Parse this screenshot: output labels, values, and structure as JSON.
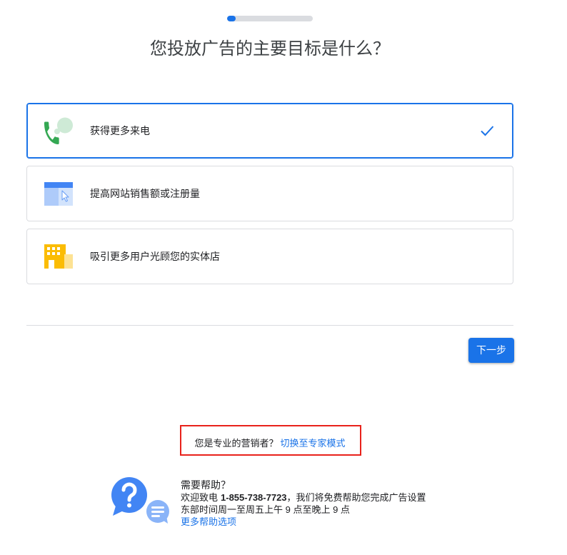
{
  "progress": {
    "percent": 10
  },
  "colors": {
    "accent": "#1a73e8",
    "text": "#202124",
    "border": "#dadce0",
    "highlight": "#e8221b"
  },
  "title": "您投放广告的主要目标是什么？",
  "selected_icon": "check-icon",
  "goals": [
    {
      "label": "获得更多来电",
      "icon": "phone-icon",
      "selected": true
    },
    {
      "label": "提高网站销售额或注册量",
      "icon": "website-icon",
      "selected": false
    },
    {
      "label": "吸引更多用户光顾您的实体店",
      "icon": "storefront-icon",
      "selected": false
    }
  ],
  "next_button": {
    "label": "下一步"
  },
  "expert_mode": {
    "prompt": "您是专业的营销者？",
    "link": "切换至专家模式"
  },
  "help": {
    "icon": "help-chat-icon",
    "heading": "需要帮助？",
    "call_prefix": "欢迎致电",
    "phone": "1-855-738-7723",
    "call_suffix": "，我们将免费帮助您完成广告设置",
    "hours": "东部时间周一至周五上午 9 点至晚上 9 点",
    "more_link": "更多帮助选项"
  }
}
